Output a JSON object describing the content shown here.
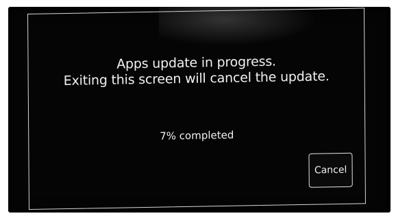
{
  "dialog": {
    "message_line1": "Apps update in progress.",
    "message_line2": "Exiting this screen will cancel the update.",
    "progress_text": "7% completed",
    "progress_percent": 7,
    "cancel_label": "Cancel"
  },
  "colors": {
    "screen_background": "#050505",
    "text": "#f2f2f2",
    "border": "#d8d8d8"
  }
}
